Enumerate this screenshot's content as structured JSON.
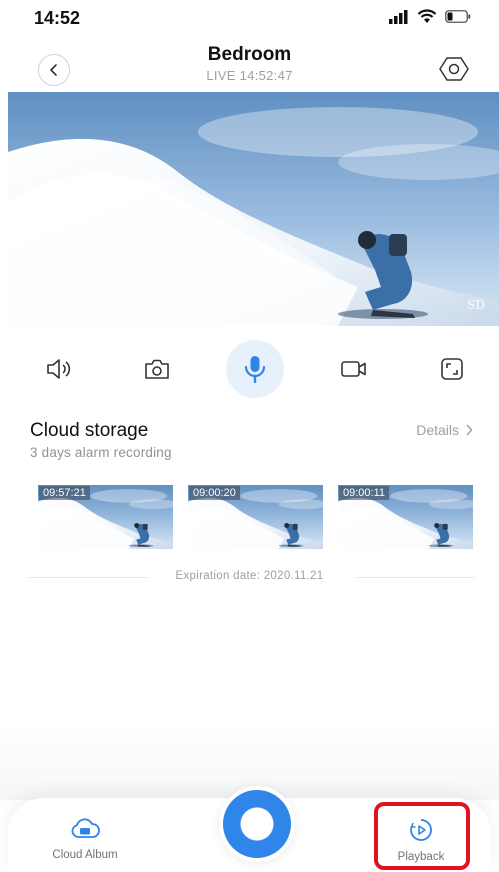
{
  "status_bar": {
    "time": "14:52"
  },
  "header": {
    "title": "Bedroom",
    "live_status": "LIVE 14:52:47"
  },
  "video": {
    "quality_badge": "SD"
  },
  "controls": [
    {
      "icon": "speaker-icon"
    },
    {
      "icon": "camera-icon"
    },
    {
      "icon": "microphone-icon",
      "active": true
    },
    {
      "icon": "video-record-icon"
    },
    {
      "icon": "fullscreen-icon"
    }
  ],
  "cloud_storage": {
    "title": "Cloud storage",
    "subtitle": "3 days alarm recording",
    "details_label": "Details",
    "clips": [
      {
        "time": "09:57:21"
      },
      {
        "time": "09:00:20"
      },
      {
        "time": "09:00:11"
      }
    ],
    "expiration": "Expiration date: 2020.11.21"
  },
  "bottom_nav": {
    "cloud_album_label": "Cloud Album",
    "playback_label": "Playback"
  },
  "colors": {
    "accent": "#2f85e8",
    "highlight": "#e0141e",
    "muted_text": "#9aa0a6"
  }
}
